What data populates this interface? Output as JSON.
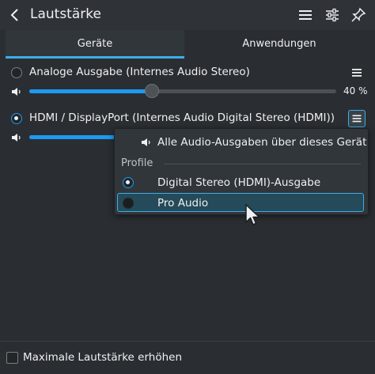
{
  "header": {
    "title": "Lautstärke"
  },
  "tabs": [
    {
      "label": "Geräte",
      "active": true
    },
    {
      "label": "Anwendungen",
      "active": false
    }
  ],
  "devices": [
    {
      "label": "Analoge Ausgabe (Internes Audio Stereo)",
      "selected": false,
      "volume_text": "40 %",
      "volume": 0.4
    },
    {
      "label": "HDMI / DisplayPort (Internes Audio Digital Stereo (HDMI))",
      "selected": true,
      "volume": 0.55
    }
  ],
  "popup": {
    "play_all_label": "Alle Audio-Ausgaben über dieses Gerät",
    "section_title": "Profile",
    "profiles": [
      {
        "label": "Digital Stereo (HDMI)-Ausgabe",
        "selected": true
      },
      {
        "label": "Pro Audio",
        "selected": false,
        "hovered": true
      }
    ]
  },
  "footer": {
    "raise_max_label": "Maximale Lautstärke erhöhen",
    "checked": false
  },
  "colors": {
    "accent": "#3daee9",
    "background": "#2a2e32"
  }
}
